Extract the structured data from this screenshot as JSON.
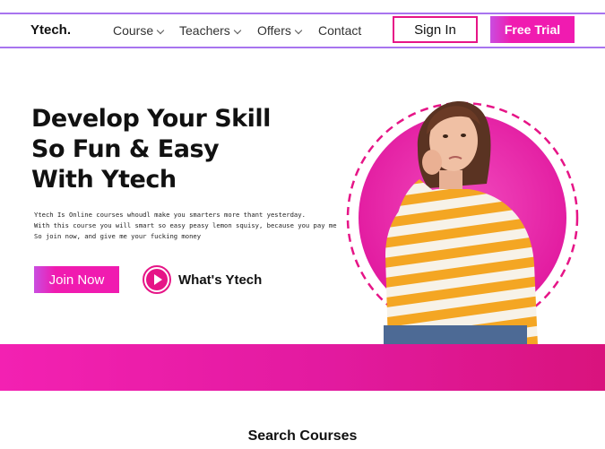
{
  "header": {
    "logo": "Ytech.",
    "nav": [
      {
        "label": "Course"
      },
      {
        "label": "Teachers"
      },
      {
        "label": "Offers"
      },
      {
        "label": "Contact"
      }
    ],
    "signin_label": "Sign In",
    "trial_label": "Free Trial"
  },
  "hero": {
    "title_lines": [
      "Develop Your Skill",
      "So Fun & Easy",
      "With Ytech"
    ],
    "desc_lines": [
      "Ytech Is Online courses whoudl make you smarters more thant yesterday.",
      "With this course you will smart so easy peasy lemon squisy, because you pay me",
      "So join now, and give me your fucking money"
    ],
    "join_label": "Join Now",
    "whats_label": "What's Ytech"
  },
  "search": {
    "title": "Search Courses"
  },
  "colors": {
    "accent": "#e61587",
    "border": "#a874ef",
    "band": "#e21a9f"
  }
}
